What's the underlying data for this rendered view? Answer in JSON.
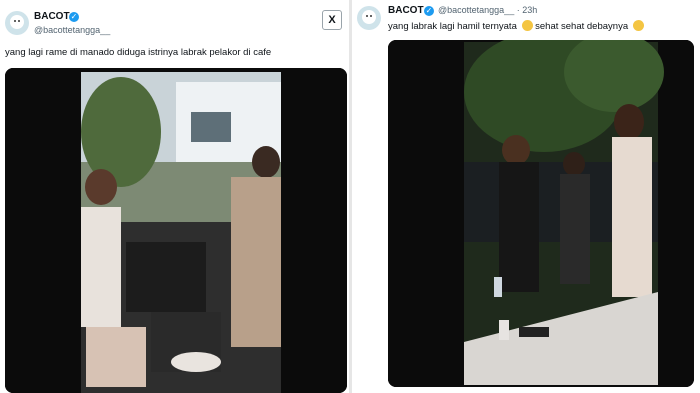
{
  "left_tweet": {
    "name": "BACOT",
    "handle": "@bacottetangga__",
    "text": "yang lagi rame di manado diduga istrinya labrak pelakor di cafe"
  },
  "right_tweet": {
    "name": "BACOT",
    "handle": "@bacottetangga__ · 23h",
    "text_part1": "yang labrak lagi hamil ternyata",
    "text_part2": "sehat sehat debaynya"
  },
  "x_logo": "X",
  "colors": {
    "verified": "#1d9bf0",
    "handle": "#536471",
    "text": "#0f1419"
  }
}
